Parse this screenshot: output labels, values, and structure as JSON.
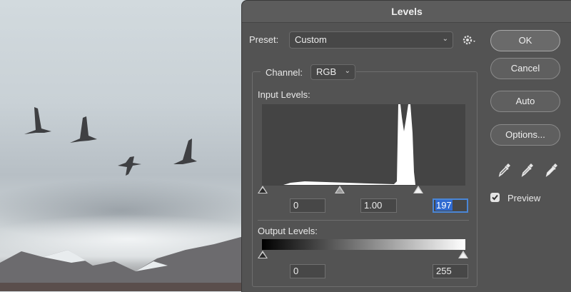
{
  "dialog": {
    "title": "Levels"
  },
  "preset": {
    "label": "Preset:",
    "value": "Custom",
    "menu_icon": "gear-icon"
  },
  "channel": {
    "label": "Channel:",
    "value": "RGB"
  },
  "input_levels": {
    "label": "Input Levels:",
    "black": "0",
    "gamma": "1.00",
    "white": "197"
  },
  "output_levels": {
    "label": "Output Levels:",
    "black": "0",
    "white": "255"
  },
  "buttons": {
    "ok": "OK",
    "cancel": "Cancel",
    "auto": "Auto",
    "options": "Options..."
  },
  "eyedroppers": [
    "black-eyedropper-icon",
    "gray-eyedropper-icon",
    "white-eyedropper-icon"
  ],
  "preview": {
    "label": "Preview",
    "checked": true
  }
}
